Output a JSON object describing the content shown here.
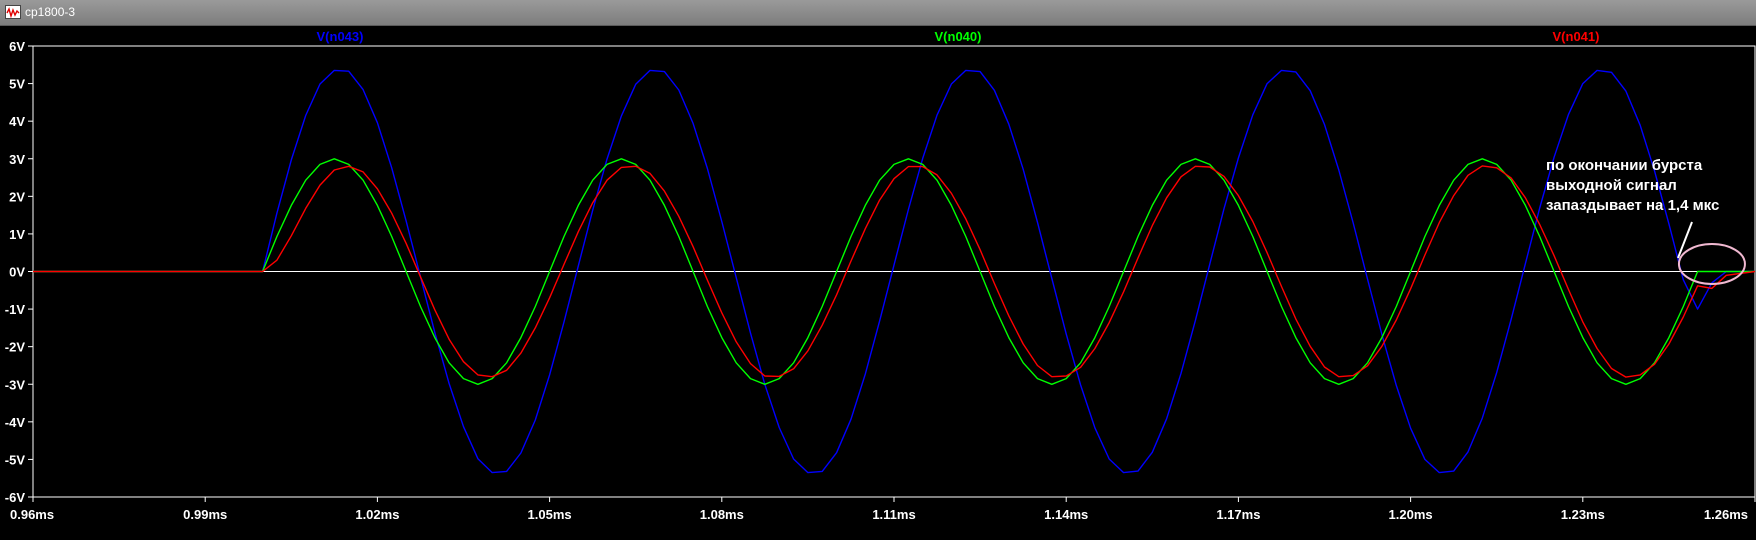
{
  "window": {
    "title": "cp1800-3"
  },
  "chart_data": {
    "type": "line",
    "xlim": [
      0.96,
      1.26
    ],
    "ylim": [
      -6,
      6
    ],
    "x_ticks": [
      0.96,
      0.99,
      1.02,
      1.05,
      1.08,
      1.11,
      1.14,
      1.17,
      1.2,
      1.23,
      1.26
    ],
    "x_tick_labels": [
      "0.96ms",
      "0.99ms",
      "1.02ms",
      "1.05ms",
      "1.08ms",
      "1.11ms",
      "1.14ms",
      "1.17ms",
      "1.20ms",
      "1.23ms",
      "1.26ms"
    ],
    "y_ticks": [
      6,
      5,
      4,
      3,
      2,
      1,
      0,
      -1,
      -2,
      -3,
      -4,
      -5,
      -6
    ],
    "y_tick_labels": [
      "6V",
      "5V",
      "4V",
      "3V",
      "2V",
      "1V",
      "0V",
      "-1V",
      "-2V",
      "-3V",
      "-4V",
      "-5V",
      "-6V"
    ],
    "grid": false,
    "zero_line": true,
    "series": [
      {
        "name": "V(n043)",
        "color": "#0000ff",
        "x": [
          0.96,
          1.0,
          1.0025,
          1.005,
          1.0075,
          1.01,
          1.0125,
          1.015,
          1.0175,
          1.02,
          1.0225,
          1.025,
          1.0275,
          1.03,
          1.0325,
          1.035,
          1.0375,
          1.04,
          1.0425,
          1.045,
          1.0475,
          1.05,
          1.0525,
          1.055,
          1.0575,
          1.06,
          1.0625,
          1.065,
          1.0675,
          1.07,
          1.0725,
          1.075,
          1.0775,
          1.08,
          1.0825,
          1.085,
          1.0875,
          1.09,
          1.0925,
          1.095,
          1.0975,
          1.1,
          1.1025,
          1.105,
          1.1075,
          1.11,
          1.1125,
          1.115,
          1.1175,
          1.12,
          1.1225,
          1.125,
          1.1275,
          1.13,
          1.1325,
          1.135,
          1.1375,
          1.14,
          1.1425,
          1.145,
          1.1475,
          1.15,
          1.1525,
          1.155,
          1.1575,
          1.16,
          1.1625,
          1.165,
          1.1675,
          1.17,
          1.1725,
          1.175,
          1.1775,
          1.18,
          1.1825,
          1.185,
          1.1875,
          1.19,
          1.1925,
          1.195,
          1.1975,
          1.2,
          1.2025,
          1.205,
          1.2075,
          1.21,
          1.2125,
          1.215,
          1.2175,
          1.22,
          1.2225,
          1.225,
          1.2275,
          1.23,
          1.2325,
          1.235,
          1.2375,
          1.24,
          1.2425,
          1.245,
          1.2475,
          1.25,
          1.2525,
          1.255,
          1.26
        ],
        "y": [
          0,
          0,
          1.55,
          2.97,
          4.15,
          4.99,
          5.35,
          5.33,
          4.84,
          3.96,
          2.76,
          1.35,
          -0.14,
          -1.62,
          -2.98,
          -4.13,
          -4.98,
          -5.35,
          -5.32,
          -4.83,
          -3.95,
          -2.75,
          -1.34,
          0.15,
          1.63,
          2.99,
          4.14,
          4.98,
          5.35,
          5.32,
          4.83,
          3.94,
          2.74,
          1.33,
          -0.16,
          -1.64,
          -3.0,
          -4.15,
          -4.99,
          -5.35,
          -5.32,
          -4.82,
          -3.93,
          -2.73,
          -1.32,
          0.17,
          1.65,
          3.01,
          4.16,
          4.99,
          5.35,
          5.32,
          4.82,
          3.92,
          2.72,
          1.31,
          -0.18,
          -1.66,
          -3.02,
          -4.16,
          -4.99,
          -5.35,
          -5.31,
          -4.81,
          -3.92,
          -2.71,
          -1.3,
          0.19,
          1.67,
          3.02,
          4.17,
          5.0,
          5.35,
          5.31,
          4.81,
          3.91,
          2.7,
          1.29,
          -0.2,
          -1.68,
          -3.03,
          -4.17,
          -5.0,
          -5.35,
          -5.31,
          -4.8,
          -3.9,
          -2.69,
          -1.28,
          0.21,
          1.69,
          3.04,
          4.18,
          5.0,
          5.35,
          5.3,
          4.8,
          3.89,
          2.68,
          1.27,
          -0.22,
          -1.0,
          -0.3,
          0,
          0
        ]
      },
      {
        "name": "V(n040)",
        "color": "#00ff00",
        "x": [
          0.96,
          1.0,
          1.0025,
          1.005,
          1.0075,
          1.01,
          1.0125,
          1.015,
          1.0175,
          1.02,
          1.0225,
          1.025,
          1.0275,
          1.03,
          1.0325,
          1.035,
          1.0375,
          1.04,
          1.0425,
          1.045,
          1.0475,
          1.05,
          1.0525,
          1.055,
          1.0575,
          1.06,
          1.0625,
          1.065,
          1.0675,
          1.07,
          1.0725,
          1.075,
          1.0775,
          1.08,
          1.0825,
          1.085,
          1.0875,
          1.09,
          1.0925,
          1.095,
          1.0975,
          1.1,
          1.1025,
          1.105,
          1.1075,
          1.11,
          1.1125,
          1.115,
          1.1175,
          1.12,
          1.1225,
          1.125,
          1.1275,
          1.13,
          1.1325,
          1.135,
          1.1375,
          1.14,
          1.1425,
          1.145,
          1.1475,
          1.15,
          1.1525,
          1.155,
          1.1575,
          1.16,
          1.1625,
          1.165,
          1.1675,
          1.17,
          1.1725,
          1.175,
          1.1775,
          1.18,
          1.1825,
          1.185,
          1.1875,
          1.19,
          1.1925,
          1.195,
          1.1975,
          1.2,
          1.2025,
          1.205,
          1.2075,
          1.21,
          1.2125,
          1.215,
          1.2175,
          1.22,
          1.2225,
          1.225,
          1.2275,
          1.23,
          1.2325,
          1.235,
          1.2375,
          1.24,
          1.2425,
          1.245,
          1.2475,
          1.25,
          1.26
        ],
        "y": [
          0,
          0,
          0.93,
          1.76,
          2.43,
          2.85,
          3.0,
          2.85,
          2.43,
          1.76,
          0.93,
          0,
          -0.93,
          -1.76,
          -2.43,
          -2.85,
          -3.0,
          -2.85,
          -2.43,
          -1.76,
          -0.93,
          0,
          0.93,
          1.76,
          2.43,
          2.85,
          3.0,
          2.85,
          2.43,
          1.76,
          0.93,
          0,
          -0.93,
          -1.76,
          -2.43,
          -2.85,
          -3.0,
          -2.85,
          -2.43,
          -1.76,
          -0.93,
          0,
          0.93,
          1.76,
          2.43,
          2.85,
          3.0,
          2.85,
          2.43,
          1.76,
          0.93,
          0,
          -0.93,
          -1.76,
          -2.43,
          -2.85,
          -3.0,
          -2.85,
          -2.43,
          -1.76,
          -0.93,
          0,
          0.93,
          1.76,
          2.43,
          2.85,
          3.0,
          2.85,
          2.43,
          1.76,
          0.93,
          0,
          -0.93,
          -1.76,
          -2.43,
          -2.85,
          -3.0,
          -2.85,
          -2.43,
          -1.76,
          -0.93,
          0,
          0.93,
          1.76,
          2.43,
          2.85,
          3.0,
          2.85,
          2.43,
          1.76,
          0.93,
          0,
          -0.93,
          -1.76,
          -2.43,
          -2.85,
          -3.0,
          -2.85,
          -2.43,
          -1.76,
          -0.93,
          0,
          0
        ]
      },
      {
        "name": "V(n041)",
        "color": "#ff0000",
        "x": [
          0.96,
          1.0,
          1.0025,
          1.005,
          1.0075,
          1.01,
          1.0125,
          1.015,
          1.0175,
          1.02,
          1.0225,
          1.025,
          1.0275,
          1.03,
          1.0325,
          1.035,
          1.0375,
          1.04,
          1.0425,
          1.045,
          1.0475,
          1.05,
          1.0525,
          1.055,
          1.0575,
          1.06,
          1.0625,
          1.065,
          1.0675,
          1.07,
          1.0725,
          1.075,
          1.0775,
          1.08,
          1.0825,
          1.085,
          1.0875,
          1.09,
          1.0925,
          1.095,
          1.0975,
          1.1,
          1.1025,
          1.105,
          1.1075,
          1.11,
          1.1125,
          1.115,
          1.1175,
          1.12,
          1.1225,
          1.125,
          1.1275,
          1.13,
          1.1325,
          1.135,
          1.1375,
          1.14,
          1.1425,
          1.145,
          1.1475,
          1.15,
          1.1525,
          1.155,
          1.1575,
          1.16,
          1.1625,
          1.165,
          1.1675,
          1.17,
          1.1725,
          1.175,
          1.1775,
          1.18,
          1.1825,
          1.185,
          1.1875,
          1.19,
          1.1925,
          1.195,
          1.1975,
          1.2,
          1.2025,
          1.205,
          1.2075,
          1.21,
          1.2125,
          1.215,
          1.2175,
          1.22,
          1.2225,
          1.225,
          1.2275,
          1.23,
          1.2325,
          1.235,
          1.2375,
          1.24,
          1.2425,
          1.245,
          1.2475,
          1.25,
          1.2525,
          1.255,
          1.26
        ],
        "y": [
          0,
          0,
          0.3,
          0.95,
          1.68,
          2.3,
          2.7,
          2.8,
          2.65,
          2.2,
          1.55,
          0.75,
          -0.14,
          -1.02,
          -1.8,
          -2.4,
          -2.75,
          -2.8,
          -2.63,
          -2.17,
          -1.5,
          -0.7,
          0.19,
          1.06,
          1.83,
          2.43,
          2.77,
          2.8,
          2.61,
          2.14,
          1.47,
          0.66,
          -0.23,
          -1.1,
          -1.87,
          -2.45,
          -2.78,
          -2.79,
          -2.59,
          -2.11,
          -1.43,
          -0.62,
          0.28,
          1.14,
          1.9,
          2.47,
          2.79,
          2.79,
          2.57,
          2.08,
          1.4,
          0.58,
          -0.32,
          -1.18,
          -1.93,
          -2.5,
          -2.8,
          -2.78,
          -2.55,
          -2.05,
          -1.36,
          -0.54,
          0.36,
          1.22,
          1.96,
          2.52,
          2.8,
          2.78,
          2.53,
          2.02,
          1.33,
          0.5,
          -0.4,
          -1.26,
          -1.99,
          -2.54,
          -2.8,
          -2.77,
          -2.51,
          -1.99,
          -1.29,
          -0.46,
          0.44,
          1.3,
          2.02,
          2.56,
          2.81,
          2.76,
          2.49,
          1.96,
          1.25,
          0.42,
          -0.48,
          -1.34,
          -2.05,
          -2.58,
          -2.81,
          -2.75,
          -2.47,
          -1.93,
          -1.21,
          -0.38,
          -0.45,
          -0.1,
          0
        ]
      }
    ],
    "annotation": {
      "lines": [
        "по окончании бурста",
        "выходной сигнал",
        "запаздывает на 1,4 мкс"
      ],
      "ellipse_center": [
        1.2525,
        0.2
      ],
      "ellipse_color": "#f0b8d0"
    }
  }
}
